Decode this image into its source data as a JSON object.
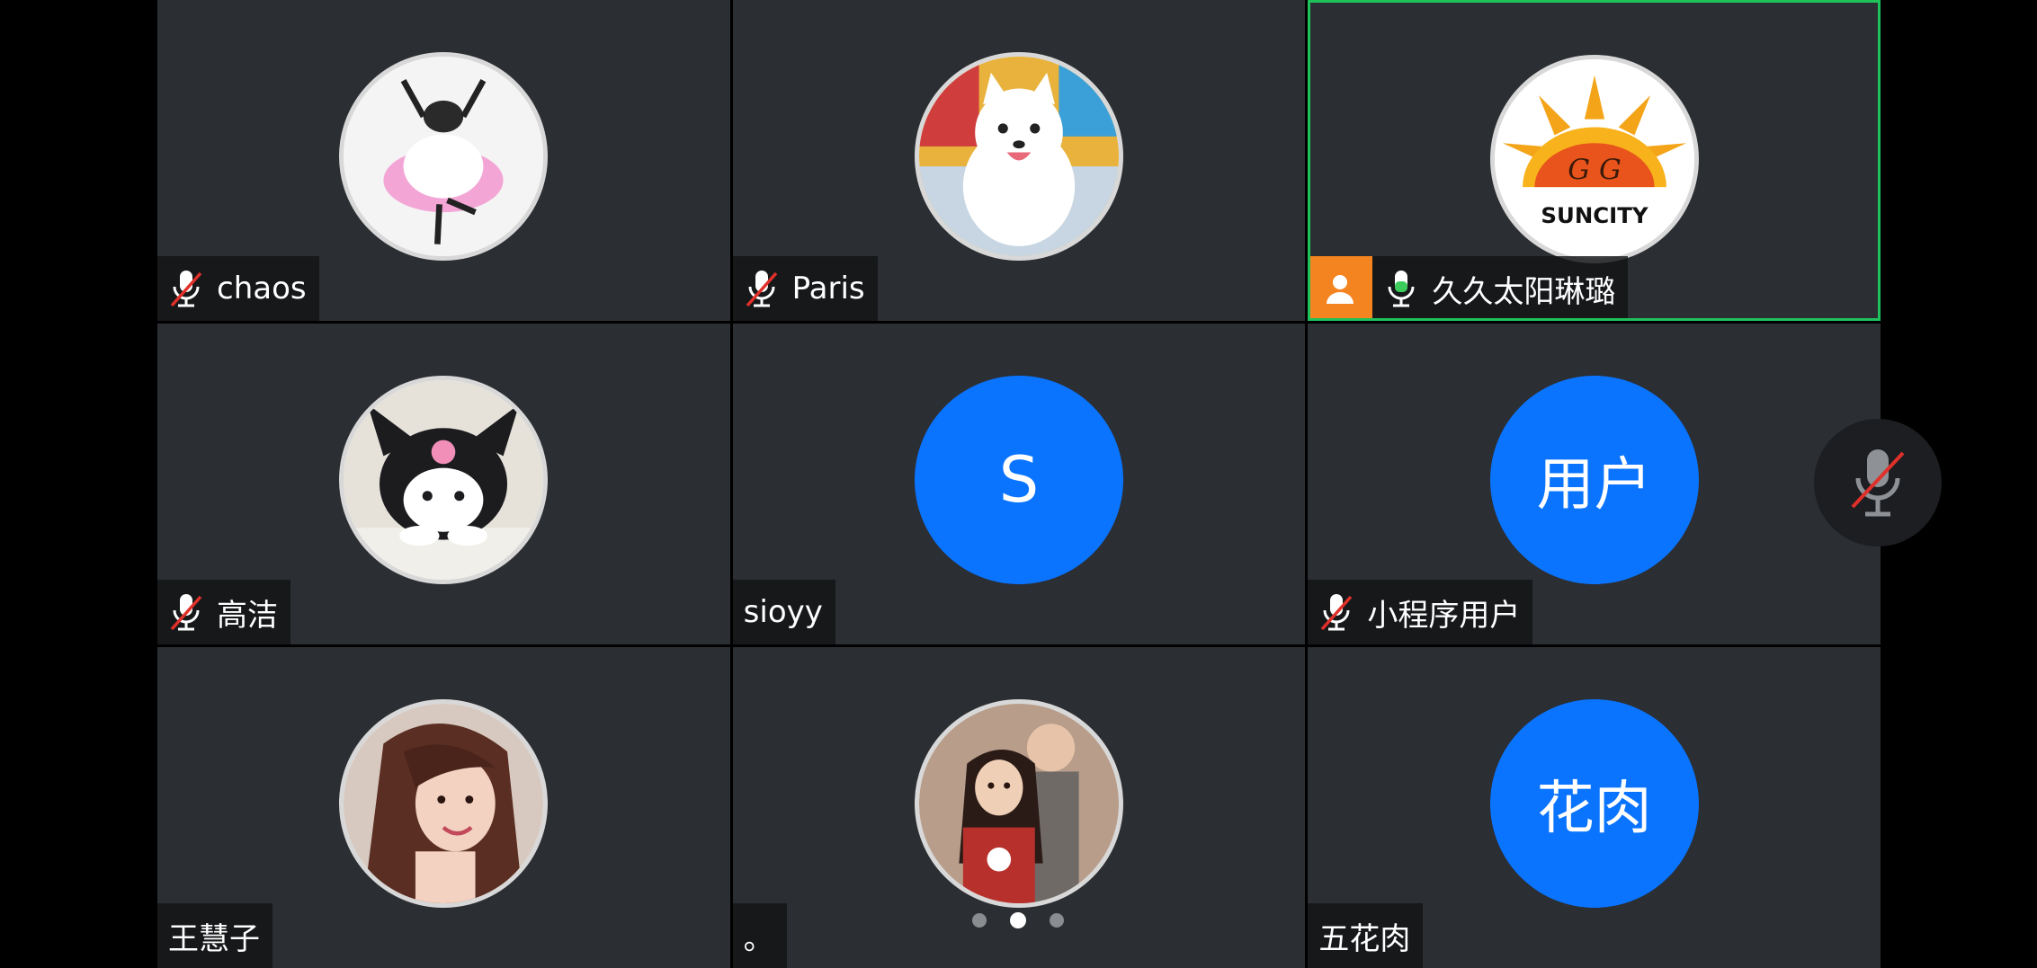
{
  "participants": [
    {
      "name": "chaos",
      "mic": "muted",
      "avatar_type": "photo",
      "avatar_desc": "sheep-ballerina-icon"
    },
    {
      "name": "Paris",
      "mic": "muted",
      "avatar_type": "photo",
      "avatar_desc": "white-puppy-icon"
    },
    {
      "name": "久久太阳琳璐",
      "mic": "on",
      "avatar_type": "photo",
      "avatar_desc": "suncity-logo-icon",
      "avatar_text": "SUNCITY",
      "host": true,
      "active_speaker": true
    },
    {
      "name": "高洁",
      "mic": "muted",
      "avatar_type": "photo",
      "avatar_desc": "kuromi-plush-icon"
    },
    {
      "name": "sioyy",
      "mic": "none",
      "avatar_type": "initials",
      "initials": "S"
    },
    {
      "name": "小程序用户",
      "mic": "muted",
      "avatar_type": "initials",
      "initials": "用户"
    },
    {
      "name": "王慧子",
      "mic": "none",
      "avatar_type": "photo",
      "avatar_desc": "woman-portrait-icon"
    },
    {
      "name": "。",
      "mic": "none",
      "avatar_type": "photo",
      "avatar_desc": "children-photo-icon"
    },
    {
      "name": "五花肉",
      "mic": "none",
      "avatar_type": "initials",
      "initials": "花肉"
    }
  ],
  "controls": {
    "side_mic": "muted"
  },
  "pager": {
    "pages": 3,
    "current": 2
  },
  "colors": {
    "tile_bg": "#2b2e32",
    "initials_bg": "#0a74ff",
    "active_border": "#1fc25a",
    "host_badge": "#f38420",
    "mute_slash": "#e0302a",
    "mic_on": "#3ccc5c"
  }
}
